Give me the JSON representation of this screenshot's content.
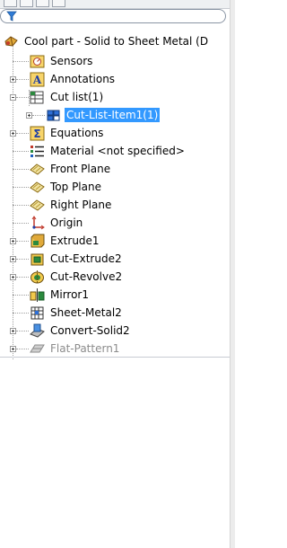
{
  "filter": {
    "icon": "filter-funnel-icon"
  },
  "tree": {
    "root": {
      "label": "Cool part - Solid to Sheet Metal  (D",
      "icon": "part-icon"
    },
    "items": [
      {
        "label": "Sensors",
        "icon": "sensors-icon"
      },
      {
        "label": "Annotations",
        "icon": "annotations-icon"
      },
      {
        "label": "Cut list(1)",
        "icon": "cut-list-icon"
      },
      {
        "label": "Cut-List-Item1(1)",
        "icon": "cut-list-item-icon",
        "selected": true
      },
      {
        "label": "Equations",
        "icon": "equations-icon"
      },
      {
        "label": "Material <not specified>",
        "icon": "material-icon"
      },
      {
        "label": "Front Plane",
        "icon": "plane-icon"
      },
      {
        "label": "Top Plane",
        "icon": "plane-icon"
      },
      {
        "label": "Right Plane",
        "icon": "plane-icon"
      },
      {
        "label": "Origin",
        "icon": "origin-icon"
      },
      {
        "label": "Extrude1",
        "icon": "extrude-icon"
      },
      {
        "label": "Cut-Extrude2",
        "icon": "cut-extrude-icon"
      },
      {
        "label": "Cut-Revolve2",
        "icon": "cut-revolve-icon"
      },
      {
        "label": "Mirror1",
        "icon": "mirror-icon"
      },
      {
        "label": "Sheet-Metal2",
        "icon": "sheet-metal-icon"
      },
      {
        "label": "Convert-Solid2",
        "icon": "convert-solid-icon"
      },
      {
        "label": "Flat-Pattern1",
        "icon": "flat-pattern-icon",
        "suppressed": true
      }
    ]
  },
  "colors": {
    "selection": "#3399ff",
    "suppressed_text": "#8c8c8c"
  }
}
